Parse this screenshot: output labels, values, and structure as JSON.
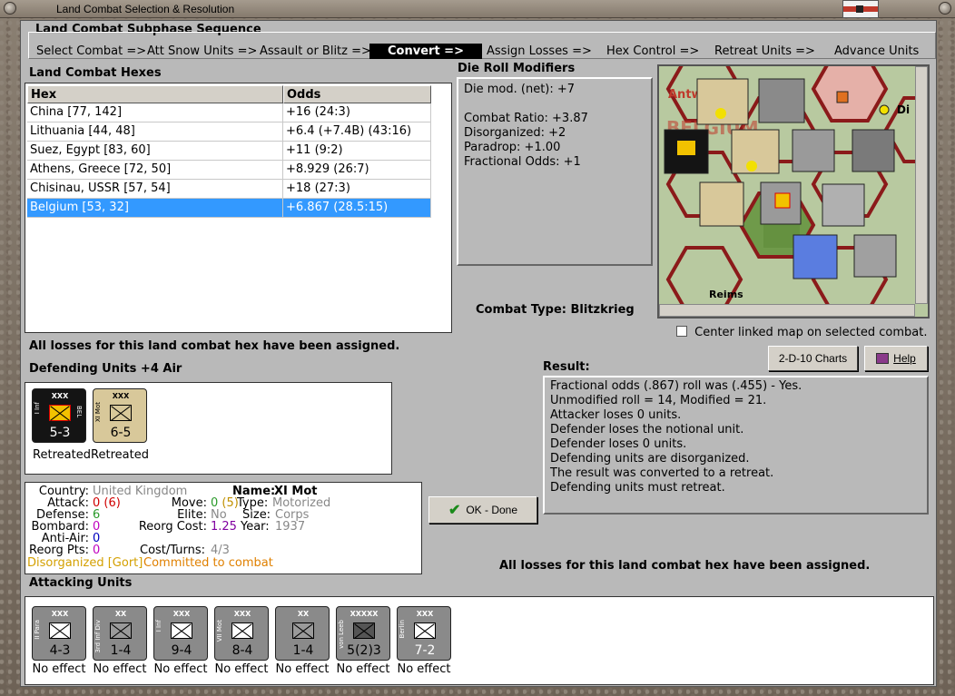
{
  "window": {
    "title": "Land Combat Selection & Resolution"
  },
  "sequence": {
    "heading": "Land Combat Subphase Sequence",
    "steps": [
      "Select Combat =>",
      "Att Snow Units =>",
      "Assault or Blitz =>",
      "Convert =>",
      "Assign Losses =>",
      "Hex Control =>",
      "Retreat Units =>",
      "Advance Units"
    ],
    "active_index": 3
  },
  "hexes": {
    "heading": "Land Combat Hexes",
    "columns": [
      "Hex",
      "Odds"
    ],
    "rows": [
      {
        "hex": "China [77, 142]",
        "odds": "+16 (24:3)"
      },
      {
        "hex": "Lithuania [44, 48]",
        "odds": "+6.4 (+7.4B) (43:16)"
      },
      {
        "hex": "Suez, Egypt [83, 60]",
        "odds": "+11 (9:2)"
      },
      {
        "hex": "Athens, Greece [72, 50]",
        "odds": "+8.929 (26:7)"
      },
      {
        "hex": "Chisinau, USSR [57, 54]",
        "odds": "+18 (27:3)"
      },
      {
        "hex": "Belgium [53, 32]",
        "odds": "+6.867 (28.5:15)"
      }
    ],
    "selected_index": 5
  },
  "modifiers": {
    "heading": "Die Roll Modifiers",
    "lines": [
      "Die mod. (net): +7",
      "",
      "Combat Ratio: +3.87",
      "Disorganized: +2",
      "Paradrop: +1.00",
      "Fractional Odds: +1"
    ]
  },
  "combat_type": {
    "label": "Combat Type:",
    "value": "Blitzkrieg"
  },
  "map": {
    "labels": [
      "Antw",
      "BELGIUM",
      "Reims",
      "Di"
    ],
    "center_option": "Center linked map on selected combat."
  },
  "losses_msg_left": "All losses for this land combat hex have been assigned.",
  "losses_msg_bottom": "All losses for this land combat hex have been assigned.",
  "defending": {
    "heading": "Defending Units +4 Air",
    "units": [
      {
        "size": "XXX",
        "side": "I Inf",
        "nation": "BEL",
        "value": "5-3",
        "status": "Retreated",
        "color": "#141414",
        "sym_color": "#f2c200",
        "text_color": "#ffffff"
      },
      {
        "size": "XXX",
        "side": "XI Mot",
        "nation": "",
        "value": "6-5",
        "status": "Retreated",
        "color": "#d8c89a",
        "sym_color": "#d8c89a",
        "text_color": "#000000"
      }
    ]
  },
  "unit_info": {
    "country_label": "Country:",
    "country": "United Kingdom",
    "name_label": "Name:",
    "name": "XI Mot",
    "attack_label": "Attack:",
    "attack": "0",
    "attack_paren": "(6)",
    "move_label": "Move:",
    "move": "0",
    "move_paren": "(5)",
    "type_label": "Type:",
    "type": "Motorized",
    "defense_label": "Defense:",
    "defense": "6",
    "elite_label": "Elite:",
    "elite": "No",
    "size_label": "Size:",
    "size": "Corps",
    "bombard_label": "Bombard:",
    "bombard": "0",
    "reorg_label": "Reorg Cost:",
    "reorg": "1.25",
    "year_label": "Year:",
    "year": "1937",
    "antiair_label": "Anti-Air:",
    "antiair": "0",
    "reorgpts_label": "Reorg Pts:",
    "reorgpts": "0",
    "costturns_label": "Cost/Turns:",
    "costturns": "4/3",
    "status_disorg": "Disorganized [Gort]",
    "status_commit": "Committed to combat"
  },
  "buttons": {
    "done": "OK - Done",
    "charts": "2-D-10 Charts",
    "help": "Help"
  },
  "result": {
    "heading": "Result:",
    "lines": [
      "Fractional odds (.867) roll was (.455)  - Yes.",
      "Unmodified roll = 14, Modified = 21.",
      "Attacker loses 0 units.",
      "Defender loses the notional unit.",
      "Defender loses 0 units.",
      "Defending units are disorganized.",
      "The result was converted to a retreat.",
      "Defending units must retreat."
    ]
  },
  "attacking": {
    "heading": "Attacking Units",
    "units": [
      {
        "size": "XXX",
        "side": "II Para",
        "value": "4-3",
        "status": "No effect"
      },
      {
        "size": "XX",
        "side": "3rd Inf Div",
        "value": "1-4",
        "status": "No effect"
      },
      {
        "size": "XXX",
        "side": "I Inf",
        "value": "9-4",
        "status": "No effect"
      },
      {
        "size": "XXX",
        "side": "VII Mot",
        "value": "8-4",
        "status": "No effect"
      },
      {
        "size": "XX",
        "side": "",
        "value": "1-4",
        "status": "No effect"
      },
      {
        "size": "XXXXX",
        "side": "von Leeb",
        "value": "5(2)3",
        "status": "No effect"
      },
      {
        "size": "XXX",
        "side": "Berlin",
        "value": "7-2",
        "status": "No effect"
      }
    ]
  },
  "colors": {
    "selected": "#3399ff",
    "disorganized": "#d4a000",
    "committed": "#e08000",
    "attack_red": "#d00000",
    "defense_green": "#2a9a2a",
    "bombard_magenta": "#c000c0",
    "antiair_blue": "#0000c0",
    "reorg_purple": "#8000a0"
  }
}
